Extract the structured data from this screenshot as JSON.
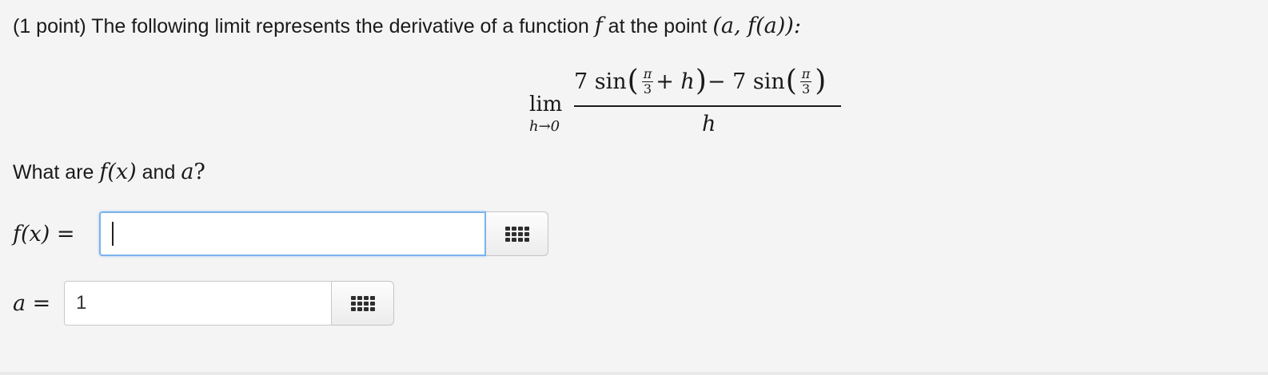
{
  "problem": {
    "points": "(1 point)",
    "statement_a": "The following limit represents the derivative of a function",
    "f": "f",
    "statement_b": "at the point",
    "point": "(a, f(a)):"
  },
  "limit": {
    "lim": "lim",
    "sub": "h→0",
    "numer_a": "7 sin",
    "frac_top": "π",
    "frac_bot": "3",
    "plus_h": " + h",
    "minus": " − 7 sin",
    "denominator": "h"
  },
  "question": {
    "text_a": "What are",
    "fx": "f(x)",
    "text_b": "and",
    "a": "a",
    "q": "?"
  },
  "fields": {
    "fx_label": "f(x) =",
    "fx_value": "",
    "a_label": "a =",
    "a_value": "1"
  },
  "icons": {
    "keyboard": "math-keyboard-icon"
  }
}
